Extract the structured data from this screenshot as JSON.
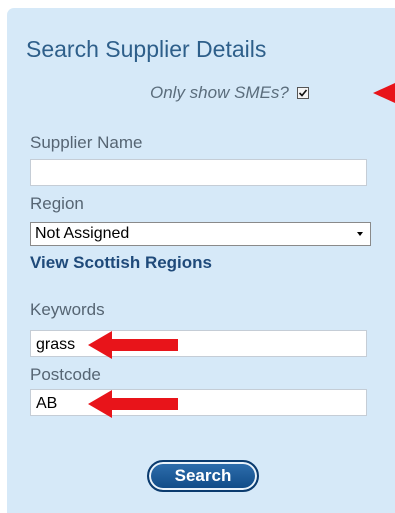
{
  "panel": {
    "title": "Search Supplier Details",
    "sme_label": "Only show SMEs?",
    "sme_checked": true
  },
  "fields": {
    "supplier_name_label": "Supplier Name",
    "supplier_name_value": "",
    "region_label": "Region",
    "region_selected": "Not Assigned",
    "regions_link": "View Scottish Regions",
    "keywords_label": "Keywords",
    "keywords_value": "grass",
    "postcode_label": "Postcode",
    "postcode_value": "AB"
  },
  "actions": {
    "search_label": "Search"
  },
  "colors": {
    "panel_background": "#d6e9f8",
    "title": "#2e5f8a",
    "link": "#1f4a7a",
    "button": "#1a5a9a",
    "annotation_arrow": "#e8141a"
  },
  "icons": {
    "sme_checkbox": "checkmark-icon",
    "region_dropdown": "chevron-down-icon",
    "annotation": "red-arrow-icon"
  }
}
